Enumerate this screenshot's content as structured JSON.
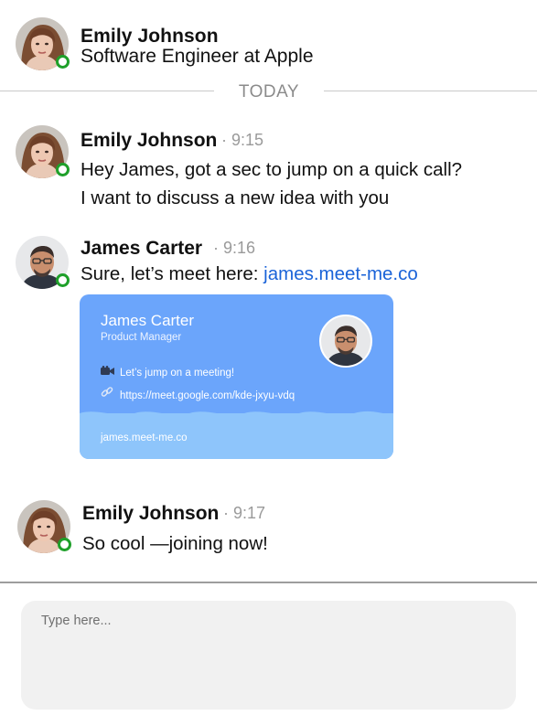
{
  "header": {
    "name": "Emily Johnson",
    "subtitle": "Software Engineer at Apple",
    "online": true
  },
  "divider": {
    "label": "TODAY"
  },
  "messages": [
    {
      "sender": "Emily Johnson",
      "time": "· 9:15",
      "lines": [
        "Hey James, got a sec to jump on a quick call?",
        "I want to discuss a new idea with you"
      ]
    },
    {
      "sender": "James Carter",
      "time": "· 9:16",
      "text": "Sure, let’s meet here: ",
      "link": "james.meet-me.co",
      "card": {
        "name": "James Carter",
        "role": "Product Manager",
        "rows": [
          {
            "icon": "video-camera-icon",
            "text": "Let’s jump on a meeting!"
          },
          {
            "icon": "link-icon",
            "text": "https://meet.google.com/kde-jxyu-vdq"
          }
        ],
        "footer": "james.meet-me.co"
      }
    },
    {
      "sender": "Emily Johnson",
      "time": "· 9:17",
      "lines": [
        "So cool —joining now!"
      ]
    }
  ],
  "composer": {
    "placeholder": "Type here..."
  },
  "colors": {
    "online": "#1fa02a",
    "link": "#1a63d8",
    "card_bg": "#6ba5fb",
    "card_footer": "#8ec5fb"
  }
}
